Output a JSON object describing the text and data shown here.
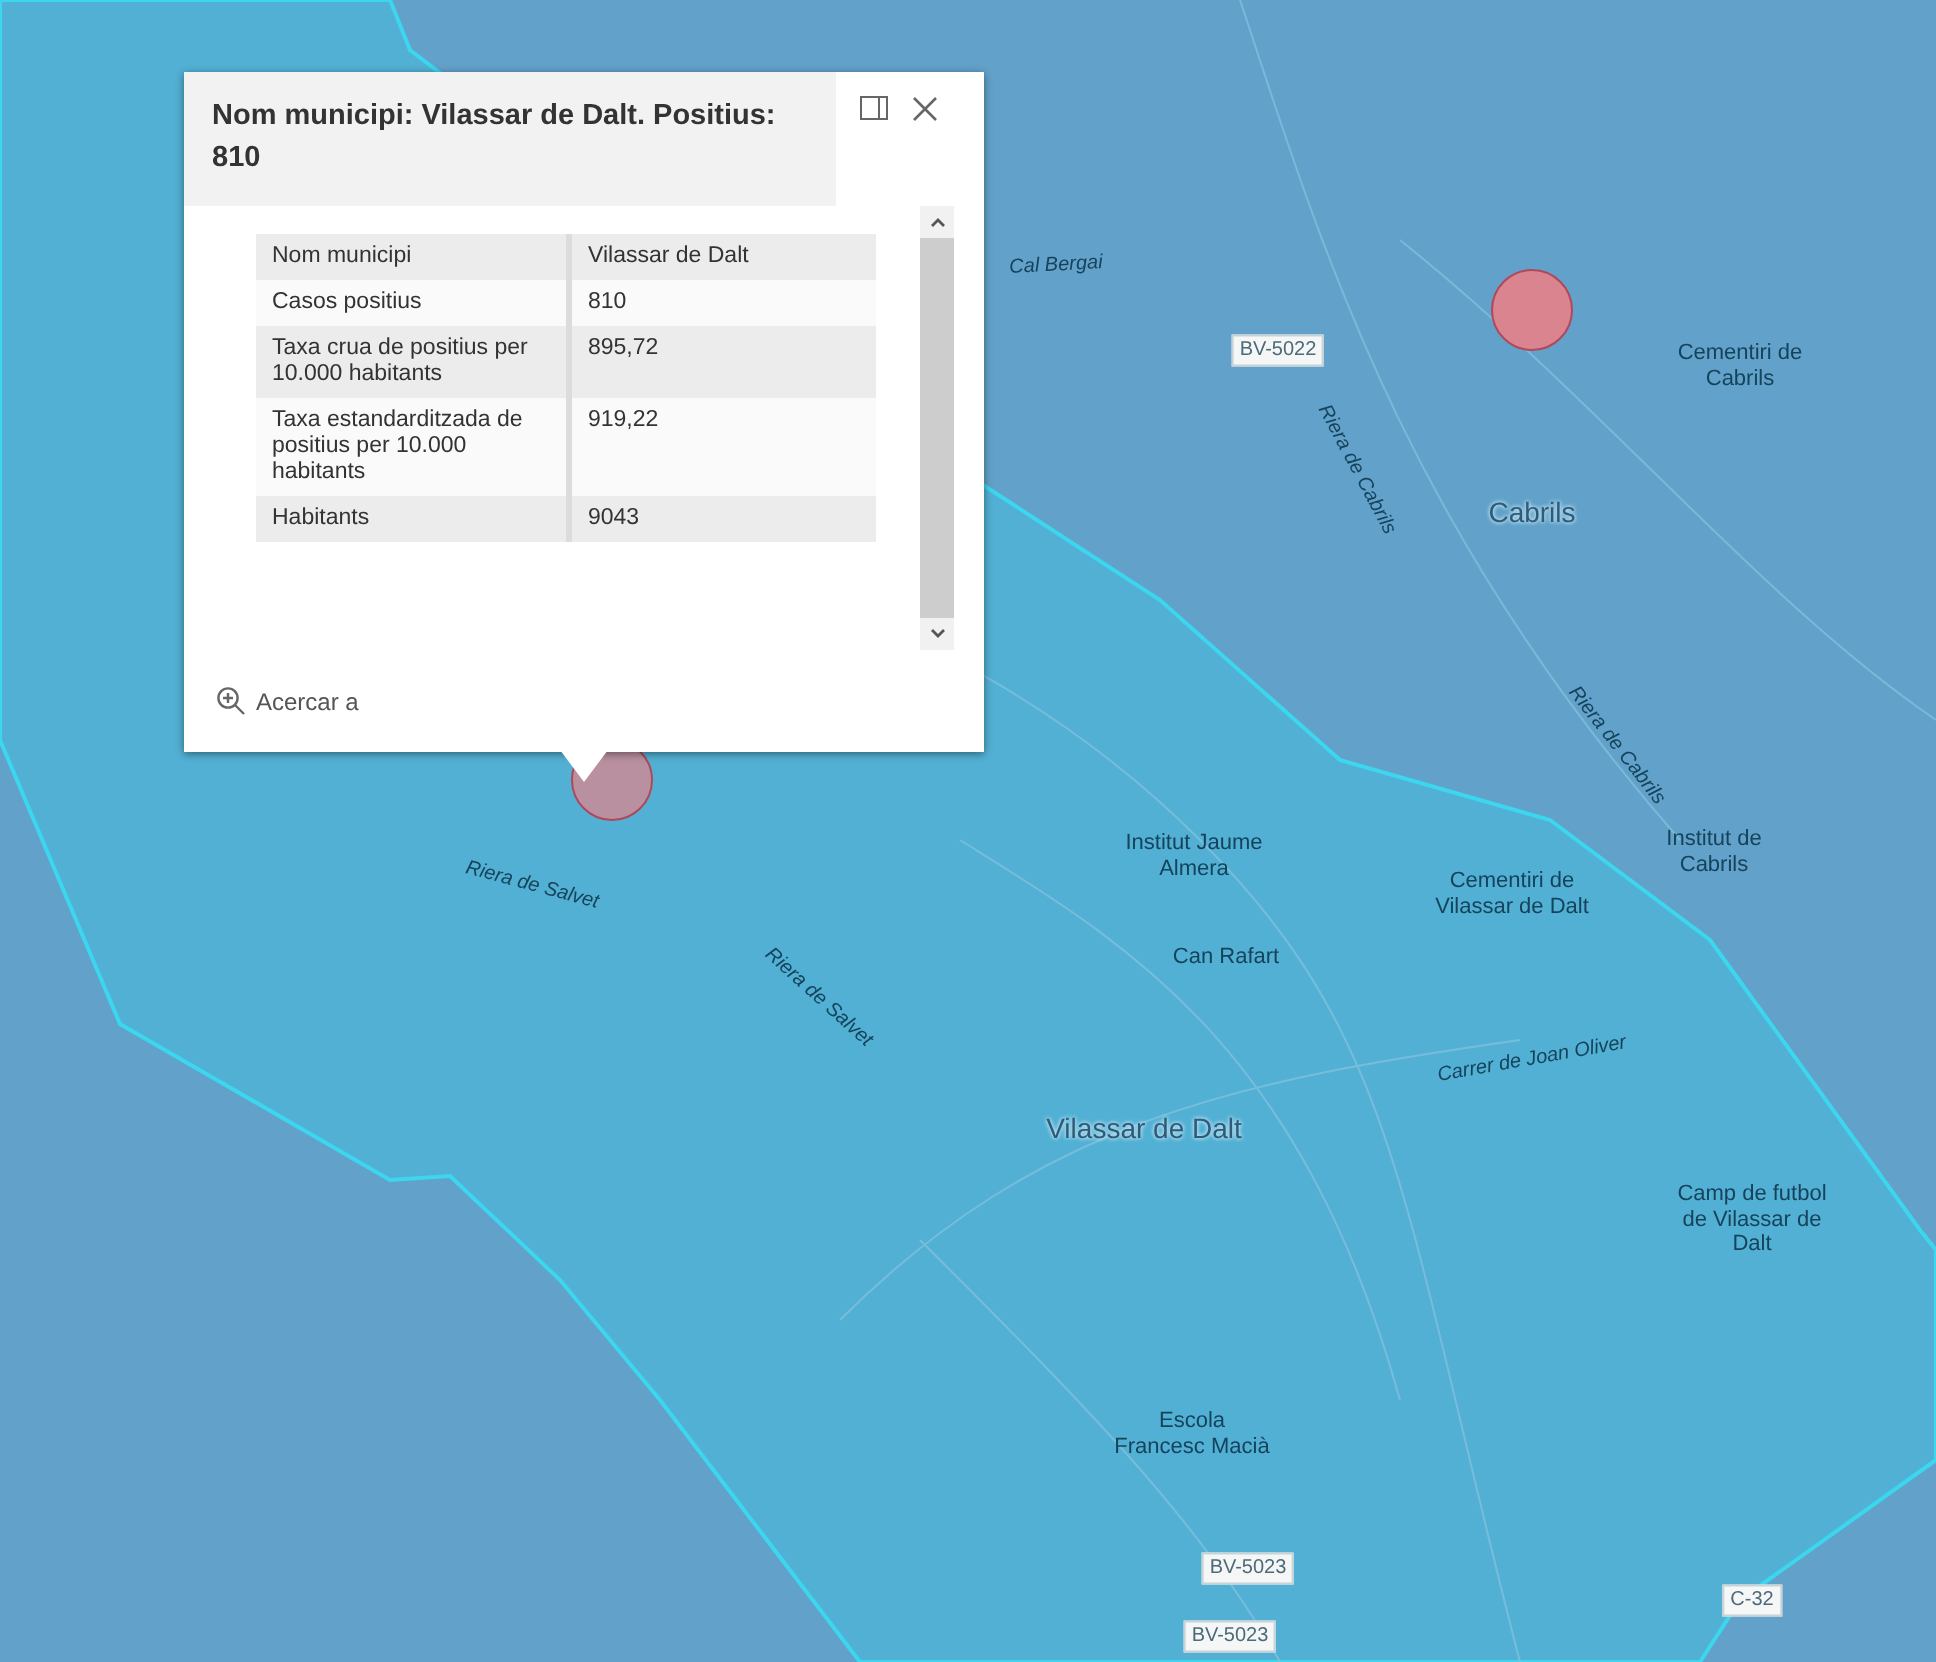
{
  "map": {
    "markers": [
      {
        "color": "#d9848f"
      },
      {
        "color": "#b9909f"
      }
    ],
    "labels": [
      {
        "kind": "street",
        "text": "Cal Bergai"
      },
      {
        "kind": "shield",
        "text": "BV-5022"
      },
      {
        "kind": "poi",
        "text": "Cementiri de Cabrils"
      },
      {
        "kind": "town",
        "text": "Cabrils"
      },
      {
        "kind": "street",
        "text": "Riera de Cabrils"
      },
      {
        "kind": "street",
        "text": "Riera de Cabrils"
      },
      {
        "kind": "poi",
        "text": "Institut Jaume Almera"
      },
      {
        "kind": "poi",
        "text": "Institut de Cabrils"
      },
      {
        "kind": "poi",
        "text": "Cementiri de Vilassar de Dalt"
      },
      {
        "kind": "poi",
        "text": "Can Rafart"
      },
      {
        "kind": "town",
        "text": "Vilassar de Dalt"
      },
      {
        "kind": "poi",
        "text": "Camp de futbol de Vilassar de Dalt"
      },
      {
        "kind": "poi",
        "text": "Escola Francesc Macià"
      },
      {
        "kind": "shield",
        "text": "BV-5023"
      },
      {
        "kind": "shield",
        "text": "BV-5023"
      },
      {
        "kind": "shield",
        "text": "C-32"
      },
      {
        "kind": "street",
        "text": "Riera de Salvet"
      },
      {
        "kind": "street",
        "text": "Riera de Salvet"
      },
      {
        "kind": "street",
        "text": "Carrer de Joan Oliver"
      }
    ]
  },
  "popup": {
    "title": "Nom municipi: Vilassar de Dalt. Positius: 810",
    "fields": [
      {
        "label": "Nom municipi",
        "value": "Vilassar de Dalt"
      },
      {
        "label": "Casos positius",
        "value": "810"
      },
      {
        "label": "Taxa crua de positius per 10.000 habitants",
        "value": "895,72"
      },
      {
        "label": "Taxa estandarditzada de positius per 10.000 habitants",
        "value": "919,22"
      },
      {
        "label": "Habitants",
        "value": "9043"
      }
    ],
    "zoom_action": "Acercar a"
  }
}
